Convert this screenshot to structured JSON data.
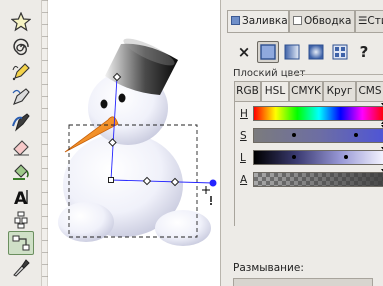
{
  "toolbox": {
    "tools": [
      "star-tool",
      "spiral-tool",
      "pencil-tool",
      "pen-tool",
      "calligraphy-tool",
      "eraser-tool",
      "paint-bucket-tool",
      "text-tool",
      "spray-tool",
      "connector-tool",
      "dropper-tool"
    ],
    "active_tool": "connector-tool"
  },
  "dock": {
    "tabs": [
      {
        "prefix": "",
        "label": "Заливка"
      },
      {
        "prefix": "",
        "label": "Обводка"
      },
      {
        "prefix": "☰",
        "label": "Стиль"
      }
    ],
    "paint_buttons": [
      "no-paint",
      "flat-color",
      "linear-gradient",
      "radial-gradient",
      "pattern",
      "unset"
    ],
    "unset_label": "?",
    "no_paint_label": "×",
    "flat_color_label": "Плоский цвет",
    "mode_tabs": [
      "RGB",
      "HSL",
      "CMYK",
      "Круг",
      "CMS"
    ],
    "active_mode": "HSL",
    "sliders": [
      {
        "label": "H"
      },
      {
        "label": "S"
      },
      {
        "label": "L"
      },
      {
        "label": "A"
      }
    ],
    "blur_label": "Размывание:"
  },
  "colors": {
    "accent_selection": "#2424ff",
    "snowman_body": "#eef0fa",
    "carrot": "#ff8c1a",
    "hat_dark": "#111111"
  }
}
